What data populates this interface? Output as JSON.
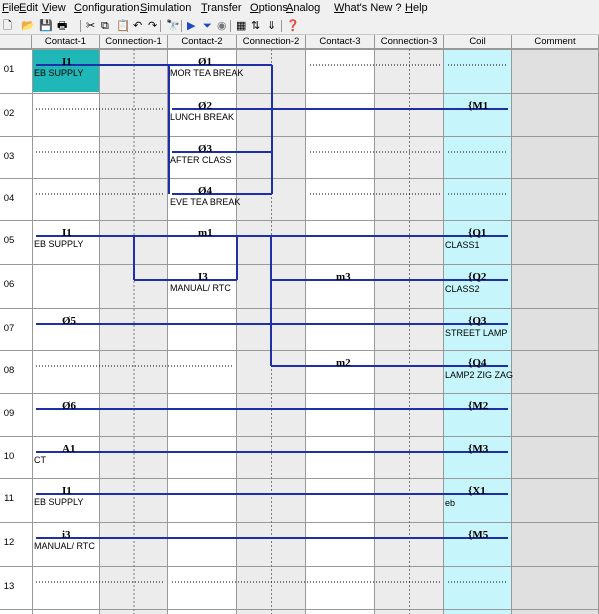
{
  "menu": [
    "File",
    "Edit",
    "View",
    "Configuration",
    "Simulation",
    "Transfer",
    "Options",
    "Analog",
    "What's New ?",
    "Help"
  ],
  "toolbar": {
    "icons": [
      "new-icon",
      "open-icon",
      "save-icon",
      "print-icon",
      "cut-icon",
      "copy-icon",
      "paste-icon",
      "undo-icon",
      "redo-icon",
      "find-icon",
      "run-icon",
      "filter-icon",
      "stop-icon",
      "grid-icon",
      "transfer-icon",
      "download-icon",
      "help-icon"
    ]
  },
  "headers": [
    "Contact-1",
    "Connection-1",
    "Contact-2",
    "Connection-2",
    "Contact-3",
    "Connection-3",
    "Coil",
    "Comment"
  ],
  "rows": [
    {
      "num": "01",
      "c1": {
        "tag": "I1",
        "label": "EB SUPPLY"
      },
      "c2": {
        "tag": "Ø1",
        "label": "MOR TEA BREAK"
      }
    },
    {
      "num": "02",
      "c2": {
        "tag": "Ø2",
        "label": "LUNCH BREAK"
      },
      "coil": {
        "tag": "M1",
        "label": ""
      }
    },
    {
      "num": "03",
      "c2": {
        "tag": "Ø3",
        "label": "AFTER CLASS"
      }
    },
    {
      "num": "04",
      "c2": {
        "tag": "Ø4",
        "label": "EVE TEA BREAK"
      }
    },
    {
      "num": "05",
      "c1": {
        "tag": "I1",
        "label": "EB SUPPLY"
      },
      "c2": {
        "tag": "m1",
        "label": ""
      },
      "coil": {
        "tag": "Q1",
        "label": "CLASS1"
      }
    },
    {
      "num": "06",
      "c2": {
        "tag": "I3",
        "label": "MANUAL/ RTC"
      },
      "c3": {
        "tag": "m3",
        "label": ""
      },
      "coil": {
        "tag": "Q2",
        "label": "CLASS2"
      }
    },
    {
      "num": "07",
      "c1": {
        "tag": "Ø5",
        "label": ""
      },
      "coil": {
        "tag": "Q3",
        "label": "STREET LAMP"
      }
    },
    {
      "num": "08",
      "c3": {
        "tag": "m2",
        "label": ""
      },
      "coil": {
        "tag": "Q4",
        "label": "LAMP2 ZIG ZAG"
      }
    },
    {
      "num": "09",
      "c1": {
        "tag": "Ø6",
        "label": ""
      },
      "coil": {
        "tag": "M2",
        "label": ""
      }
    },
    {
      "num": "10",
      "c1": {
        "tag": "A1",
        "label": "CT"
      },
      "coil": {
        "tag": "M3",
        "label": ""
      }
    },
    {
      "num": "11",
      "c1": {
        "tag": "I1",
        "label": "EB SUPPLY"
      },
      "coil": {
        "tag": "X1",
        "label": "eb"
      }
    },
    {
      "num": "12",
      "c1": {
        "tag": "i3",
        "label": "MANUAL/ RTC"
      },
      "coil": {
        "tag": "M5",
        "label": ""
      }
    },
    {
      "num": "13"
    }
  ],
  "colors": {
    "wire": "#1f2fa8",
    "coilBg": "#c6f6fb",
    "selected": "#1fb7b7",
    "comment": "#e0e0e0",
    "connBg": "#ececec",
    "grid": "#999999"
  }
}
